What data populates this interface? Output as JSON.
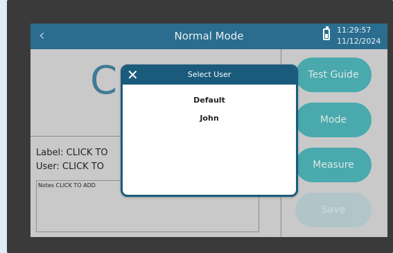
{
  "header": {
    "back_icon": "chevron-left-icon",
    "title": "Normal Mode",
    "battery_icon": "battery-icon",
    "time": "11:29:57",
    "date": "11/12/2024"
  },
  "main": {
    "big_value": "C",
    "label_line": "Label:  CLICK TO",
    "user_line": "User:    CLICK TO",
    "notes_line": "Notes CLICK TO ADD"
  },
  "side_buttons": [
    {
      "label": "Test Guide"
    },
    {
      "label": "Mode"
    },
    {
      "label": "Measure"
    },
    {
      "label": "Save"
    }
  ],
  "dialog": {
    "title": "Select User",
    "close_icon": "close-icon",
    "users": [
      {
        "label": "Default"
      },
      {
        "label": "John"
      }
    ]
  },
  "colors": {
    "header": "#2a6d8e",
    "dialog_header": "#1a5b7c",
    "button": "#1f9fa4"
  }
}
